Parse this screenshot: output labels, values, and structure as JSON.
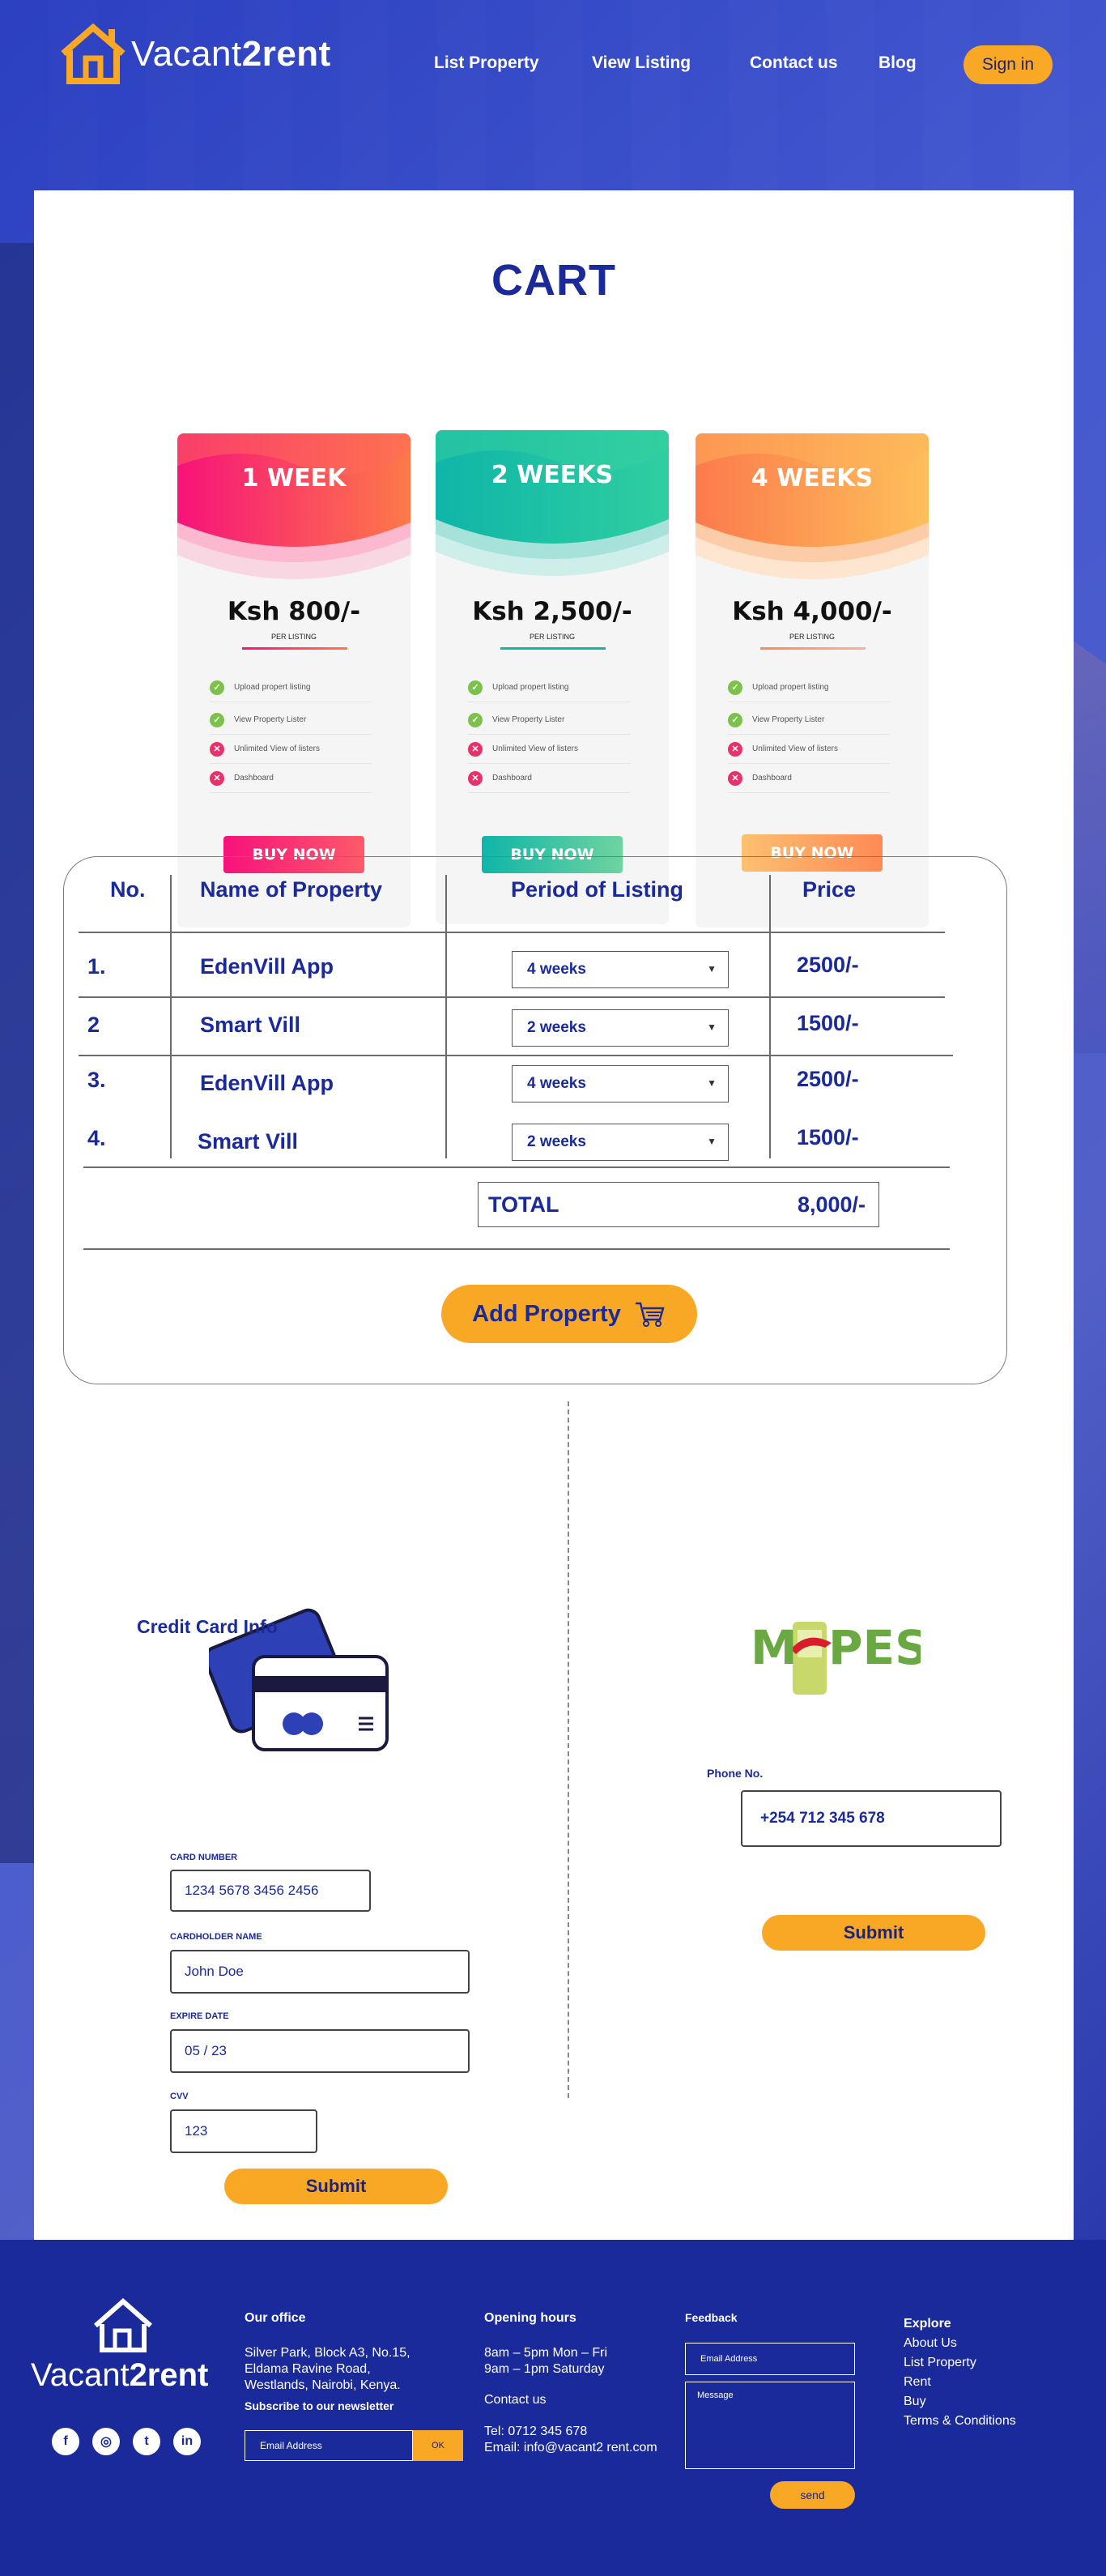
{
  "brand": {
    "name_light": "Vacant",
    "name_bold": "2rent"
  },
  "nav": {
    "items": [
      {
        "label": "List Property"
      },
      {
        "label": "View Listing"
      },
      {
        "label": "Contact us"
      },
      {
        "label": "Blog"
      }
    ],
    "signin_label": "Sign in"
  },
  "cart": {
    "title": "CART"
  },
  "plans": [
    {
      "title": "1 WEEK",
      "price": "Ksh 800/-",
      "per_listing": "PER LISTING",
      "features": [
        {
          "label": "Upload propert listing",
          "included": true
        },
        {
          "label": "View Property Lister",
          "included": true
        },
        {
          "label": "Unlimited View of listers",
          "included": false
        },
        {
          "label": "Dashboard",
          "included": false
        }
      ],
      "button_label": "BUY NOW",
      "accent": "#f0257a"
    },
    {
      "title": "2 WEEKS",
      "price": "Ksh 2,500/-",
      "per_listing": "PER LISTING",
      "features": [
        {
          "label": "Upload propert listing",
          "included": true
        },
        {
          "label": "View Property Lister",
          "included": true
        },
        {
          "label": "Unlimited View of listers",
          "included": false
        },
        {
          "label": "Dashboard",
          "included": false
        }
      ],
      "button_label": "BUY NOW",
      "accent": "#14b5a6"
    },
    {
      "title": "4 WEEKS",
      "price": "Ksh 4,000/-",
      "per_listing": "PER LISTING",
      "features": [
        {
          "label": "Upload propert listing",
          "included": true
        },
        {
          "label": "View Property Lister",
          "included": true
        },
        {
          "label": "Unlimited View of listers",
          "included": false
        },
        {
          "label": "Dashboard",
          "included": false
        }
      ],
      "button_label": "BUY NOW",
      "accent": "#fb8a4a"
    }
  ],
  "table": {
    "headers": {
      "no": "No.",
      "name": "Name of Property",
      "period": "Period of Listing",
      "price": "Price"
    },
    "rows": [
      {
        "no": "1.",
        "name": "EdenVill App",
        "period": "4 weeks",
        "price": "2500/-"
      },
      {
        "no": "2",
        "name": "Smart Vill",
        "period": "2 weeks",
        "price": "1500/-"
      },
      {
        "no": "3.",
        "name": "EdenVill App",
        "period": "4 weeks",
        "price": "2500/-"
      },
      {
        "no": "4.",
        "name": "Smart Vill",
        "period": "2 weeks",
        "price": "1500/-"
      }
    ],
    "total_label": "TOTAL",
    "total_value": "8,000/-",
    "add_button_label": "Add Property"
  },
  "credit_card": {
    "title": "Credit Card Info",
    "card_number_label": "CARD NUMBER",
    "card_number_value": "1234   5678   3456   2456",
    "holder_label": "CARDHOLDER NAME",
    "holder_value": "John Doe",
    "expiry_label": "EXPIRE DATE",
    "expiry_value": "05   /   23",
    "cvv_label": "CVV",
    "cvv_value": "123",
    "submit_label": "Submit"
  },
  "mpesa": {
    "logo_left": "M",
    "logo_right": "PESA",
    "phone_label": "Phone No.",
    "phone_value": "+254 712 345 678",
    "submit_label": "Submit"
  },
  "footer": {
    "office_title": "Our office",
    "office_address": [
      "Silver Park, Block A3, No.15,",
      "Eldama Ravine Road,",
      "Westlands, Nairobi, Kenya."
    ],
    "newsletter_title": "Subscribe to our newsletter",
    "newsletter_placeholder": "Email Address",
    "newsletter_button": "OK",
    "hours_title": "Opening hours",
    "hours": [
      "8am – 5pm Mon – Fri",
      "9am – 1pm Saturday"
    ],
    "contact_title": "Contact us",
    "tel": "Tel: 0712 345 678",
    "email": "Email: info@vacant2 rent.com",
    "feedback_title": "Feedback",
    "feedback_email_placeholder": "Email Address",
    "feedback_message_placeholder": "Message",
    "send_label": "send",
    "explore_title": "Explore",
    "explore_links": [
      "About Us",
      "List Property",
      "Rent",
      "Buy",
      "Terms & Conditions"
    ],
    "socials": [
      "facebook-icon",
      "instagram-icon",
      "twitter-icon",
      "linkedin-icon"
    ]
  },
  "colors": {
    "brand_blue": "#1a2a9a",
    "accent_orange": "#f9a825"
  }
}
